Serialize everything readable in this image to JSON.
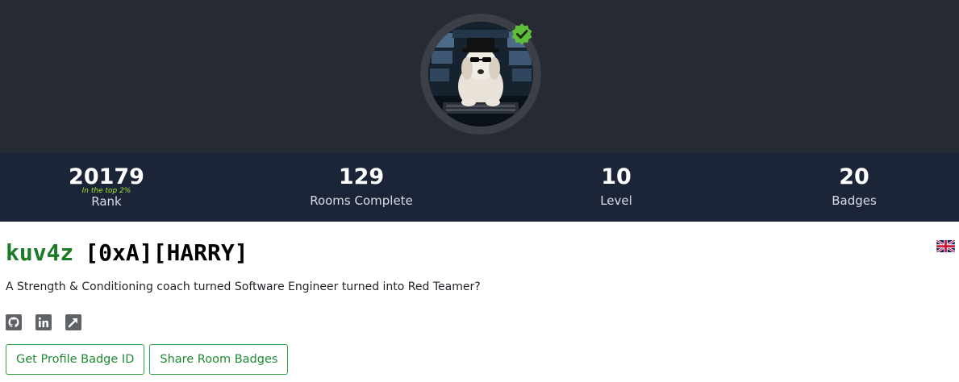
{
  "stats": [
    {
      "value": "20179",
      "label": "Rank",
      "sub": "In the top 2%"
    },
    {
      "value": "129",
      "label": "Rooms Complete"
    },
    {
      "value": "10",
      "label": "Level"
    },
    {
      "value": "20",
      "label": "Badges"
    }
  ],
  "profile": {
    "username": "kuv4z",
    "tag": "[0xA][HARRY]",
    "bio": "A Strength & Conditioning coach turned Software Engineer turned into Red Teamer?",
    "flag_icon": "uk-flag-icon",
    "verified_icon": "verified-check-icon",
    "socials": [
      {
        "icon": "github-icon"
      },
      {
        "icon": "linkedin-icon"
      },
      {
        "icon": "external-link-icon"
      }
    ]
  },
  "buttons": {
    "badge_id": "Get Profile Badge ID",
    "share_badges": "Share Room Badges"
  },
  "colors": {
    "hero_bg": "#262a33",
    "stats_bg": "#1c2538",
    "username": "#1a7a26",
    "rank_sub": "#a4ea2a",
    "button_accent": "#2fa043",
    "verified": "#5fbf3a"
  }
}
